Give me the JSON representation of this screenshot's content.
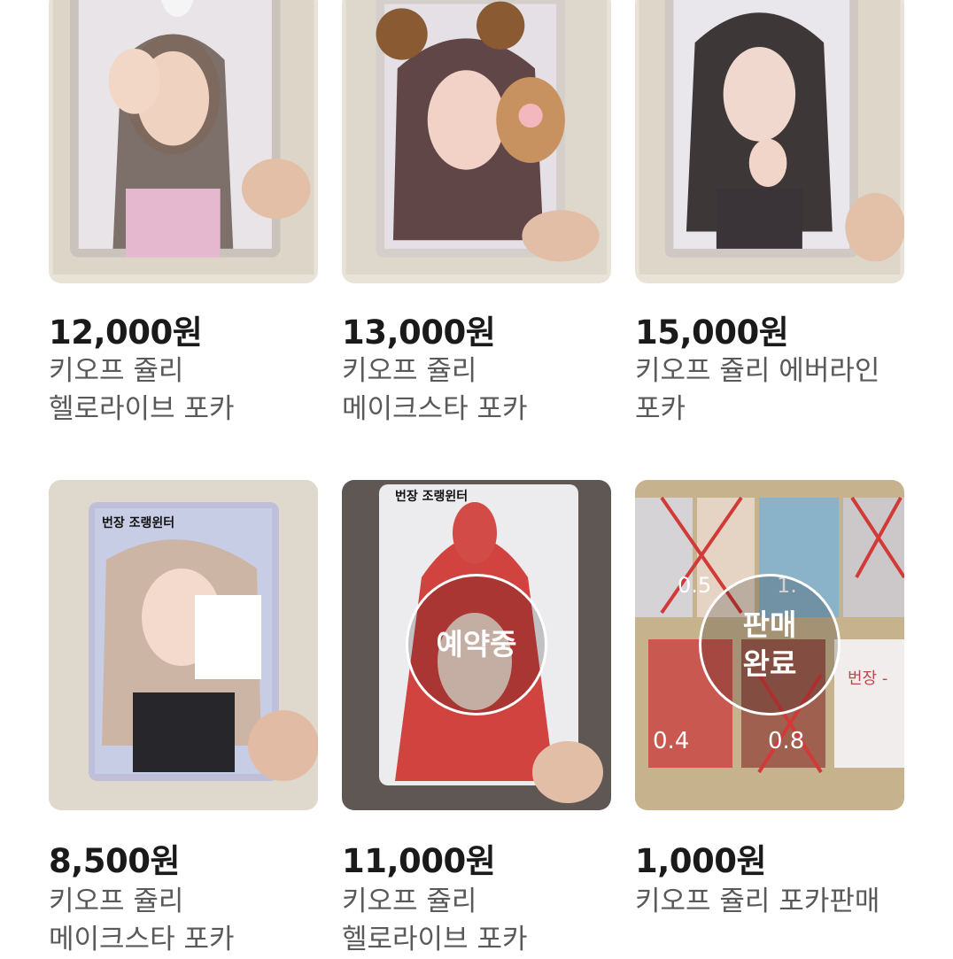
{
  "listings": [
    {
      "price": "12,000원",
      "title_line1": "키오프 쥴리",
      "title_line2": "헬로라이브 포카",
      "badge": null
    },
    {
      "price": "13,000원",
      "title_line1": "키오프 쥴리",
      "title_line2": "메이크스타 포카",
      "badge": null
    },
    {
      "price": "15,000원",
      "title_line1": "키오프 쥴리 에버라인",
      "title_line2": "포카",
      "badge": null
    },
    {
      "price": "8,500원",
      "title_line1": "키오프 쥴리",
      "title_line2": "메이크스타 포카",
      "photo_caption": "번장 조랭윈터",
      "badge": null
    },
    {
      "price": "11,000원",
      "title_line1": "키오프 쥴리",
      "title_line2": "헬로라이브 포카",
      "photo_caption": "번장 조랭윈터",
      "badge": "예약중"
    },
    {
      "price": "1,000원",
      "title_line1": "키오프 쥴리 포카판매",
      "title_line2": "",
      "photo_labels": [
        "0.5",
        "1.",
        "0.4",
        "0.8",
        "번장 -"
      ],
      "badge_line1": "판매",
      "badge_line2": "완료"
    }
  ],
  "colors": {
    "price_text": "#1a1a1a",
    "title_text": "#595959",
    "badge_border": "#ffffff"
  }
}
